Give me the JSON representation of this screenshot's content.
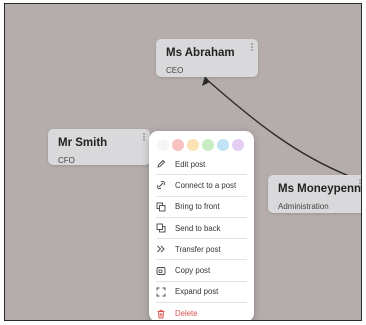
{
  "cards": {
    "abraham": {
      "name": "Ms Abraham",
      "role": "CEO"
    },
    "smith": {
      "name": "Mr Smith",
      "role": "CFO"
    },
    "moneypenny": {
      "name": "Ms Moneypenny",
      "role": "Administration"
    }
  },
  "context_menu": {
    "swatch_colors": [
      "#f5f5f5",
      "#f7c1c1",
      "#fbe3b4",
      "#c9ecc4",
      "#bfe3f5",
      "#e3cdf3"
    ],
    "items": [
      {
        "label": "Edit post",
        "icon": "pencil-icon"
      },
      {
        "label": "Connect to a post",
        "icon": "link-icon"
      },
      {
        "label": "Bring to front",
        "icon": "bring-front-icon"
      },
      {
        "label": "Send to back",
        "icon": "send-back-icon"
      },
      {
        "label": "Transfer post",
        "icon": "double-chevron-icon"
      },
      {
        "label": "Copy post",
        "icon": "copy-icon"
      },
      {
        "label": "Expand post",
        "icon": "expand-icon"
      },
      {
        "label": "Delete",
        "icon": "trash-icon"
      }
    ]
  },
  "colors": {
    "canvas": "#b4adab",
    "card": "#d9d9db",
    "danger": "#d9534f"
  }
}
